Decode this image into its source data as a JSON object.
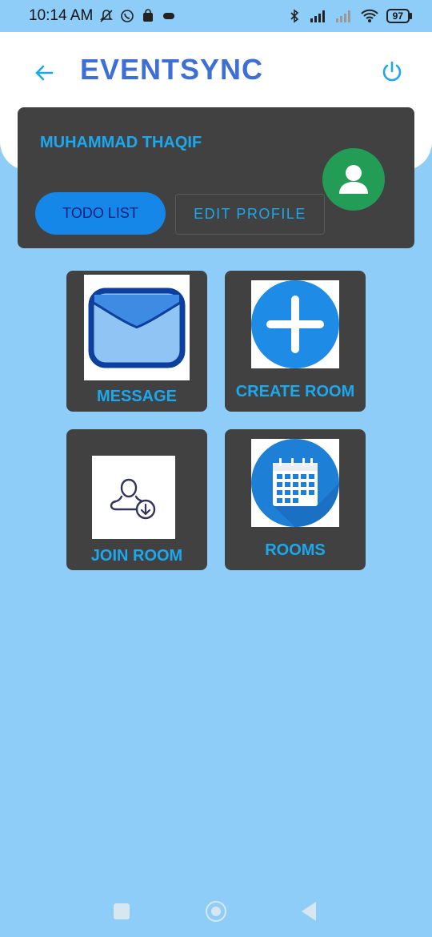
{
  "status_bar": {
    "time": "10:14 AM",
    "battery": "97"
  },
  "header": {
    "title": "EVENTSYNC"
  },
  "profile": {
    "name": "MUHAMMAD THAQIF",
    "todo_label": "TODO LIST",
    "edit_label": "EDIT PROFILE"
  },
  "tiles": [
    {
      "label": "MESSAGE",
      "icon": "envelope-icon"
    },
    {
      "label": "CREATE ROOM",
      "icon": "plus-circle-icon"
    },
    {
      "label": "JOIN ROOM",
      "icon": "user-download-icon"
    },
    {
      "label": "ROOMS",
      "icon": "calendar-icon"
    }
  ],
  "colors": {
    "background": "#8ecdf8",
    "accent": "#1ca8ef",
    "title": "#3d6fd7",
    "card": "#414141",
    "avatar": "#239c55"
  }
}
